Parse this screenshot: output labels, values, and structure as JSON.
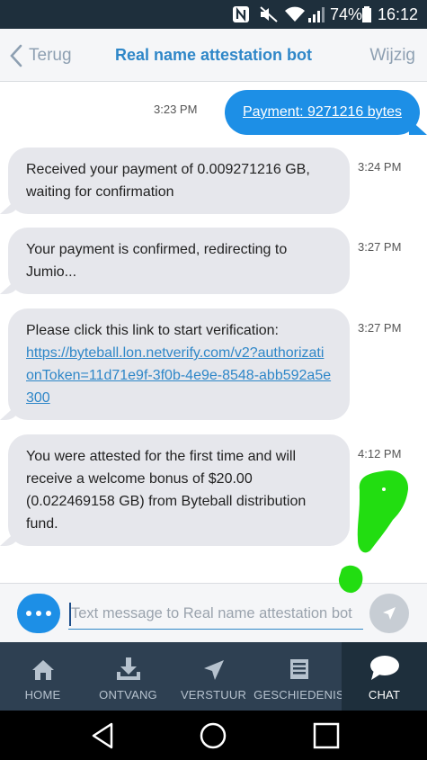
{
  "status_bar": {
    "battery": "74%",
    "time": "16:12",
    "icons": [
      "nfc-icon",
      "mute-icon",
      "wifi-icon",
      "signal-icon",
      "battery-icon"
    ]
  },
  "header": {
    "back_label": "Terug",
    "title": "Real name attestation bot",
    "edit_label": "Wijzig"
  },
  "messages": [
    {
      "from": "me",
      "time": "3:23 PM",
      "text": "Payment: 9271216 bytes"
    },
    {
      "from": "bot",
      "time": "3:24 PM",
      "text": "Received your payment of 0.009271216 GB, waiting for confirmation"
    },
    {
      "from": "bot",
      "time": "3:27 PM",
      "text": "Your payment is confirmed, redirecting to Jumio..."
    },
    {
      "from": "bot",
      "time": "3:27 PM",
      "text": "Please click this link to start verification:",
      "link": "https://byteball.lon.netverify.com/v2?authorizationToken=11d71e9f-3f0b-4e9e-8548-abb592a5e300"
    },
    {
      "from": "bot",
      "time": "4:12 PM",
      "text": "You were attested for the first time and will receive a welcome bonus of $20.00 (0.022469158 GB) from Byteball distribution fund."
    }
  ],
  "composer": {
    "placeholder": "Text message to Real name attestation bot",
    "value": ""
  },
  "tabs": [
    {
      "label": "HOME",
      "icon": "home-icon",
      "active": false
    },
    {
      "label": "ONTVANG",
      "icon": "receive-icon",
      "active": false
    },
    {
      "label": "VERSTUUR",
      "icon": "send-icon",
      "active": false
    },
    {
      "label": "GESCHIEDENIS",
      "icon": "history-icon",
      "active": false
    },
    {
      "label": "CHAT",
      "icon": "chat-icon",
      "active": true
    }
  ],
  "colors": {
    "accent": "#1d8fe6",
    "title": "#2f87c8",
    "tabbar": "#2e4052",
    "bot_bubble": "#e6e7ec",
    "annotation": "#22dd11"
  }
}
